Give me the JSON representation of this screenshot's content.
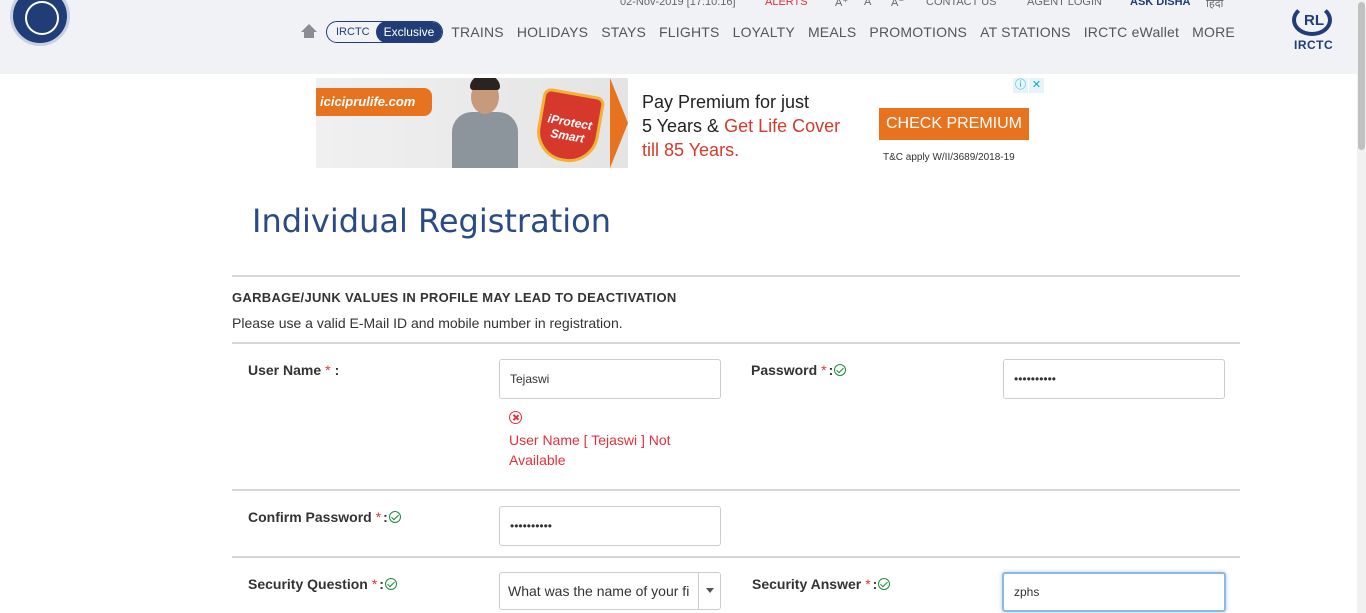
{
  "topbar": {
    "date": "02-Nov-2019 [17:10:16]",
    "alerts": "ALERTS",
    "font_up": "A⁺",
    "font_normal": "A",
    "font_down": "A⁻",
    "contact": "CONTACT US",
    "agent_login": "AGENT LOGIN",
    "ask_disha": "ASK DISHA",
    "hindi": "हिंदी"
  },
  "nav": {
    "exclusive_a": "IRCTC",
    "exclusive_b": "Exclusive",
    "items": [
      "TRAINS",
      "HOLIDAYS",
      "STAYS",
      "FLIGHTS",
      "LOYALTY",
      "MEALS",
      "PROMOTIONS",
      "AT STATIONS",
      "IRCTC eWallet",
      "MORE"
    ]
  },
  "brand": {
    "right_logo_text": "IRCTC"
  },
  "ad": {
    "site": "iciciprulife.com",
    "shield_top": "iProtect",
    "shield_bottom": "Smart",
    "line1": "Pay Premium for just",
    "line2a": "5 Years & ",
    "line2b": "Get Life Cover",
    "line3": "till 85 Years.",
    "cta": "CHECK PREMIUM",
    "tc": "T&C apply W/II/3689/2018-19",
    "info": "ⓘ",
    "close": "✕"
  },
  "form": {
    "title": "Individual Registration",
    "warning_title": "GARBAGE/JUNK VALUES IN PROFILE MAY LEAD TO DEACTIVATION",
    "warning_sub": "Please use a valid E-Mail ID and mobile number in registration.",
    "username_label": "User Name",
    "username_value": "Tejaswi",
    "username_error": "User Name [ Tejaswi ] Not Available",
    "password_label": "Password",
    "password_value": "••••••••••",
    "confirm_label": "Confirm Password",
    "confirm_value": "••••••••••",
    "secq_label": "Security Question",
    "secq_value": "What was the name of your fi",
    "seca_label": "Security Answer",
    "seca_value": "zphs",
    "required_mark": "*",
    "colon": ":"
  }
}
